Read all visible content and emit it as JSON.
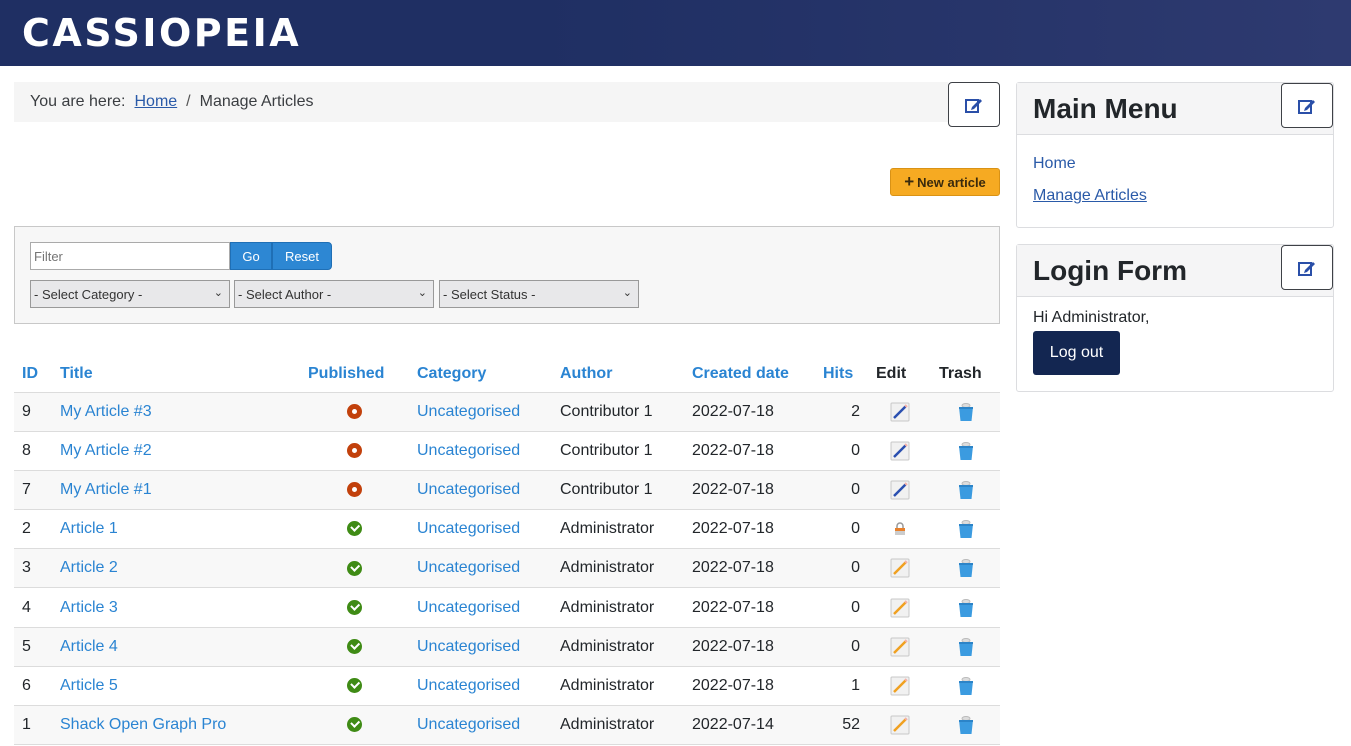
{
  "header": {
    "brand": "CASSIOPEIA"
  },
  "breadcrumb": {
    "prefix": "You are here:",
    "items": [
      {
        "label": "Home",
        "link": true
      },
      {
        "label": "Manage Articles",
        "link": false
      }
    ],
    "separator": "/",
    "edit_icon": "edit-icon"
  },
  "toolbar": {
    "new_article_label": "New article",
    "new_article_icon": "plus-icon"
  },
  "filters": {
    "filter_placeholder": "Filter",
    "filter_value": "",
    "go_label": "Go",
    "reset_label": "Reset",
    "category_selected": "- Select Category -",
    "author_selected": "- Select Author -",
    "status_selected": "- Select Status -"
  },
  "table": {
    "columns": [
      "ID",
      "Title",
      "Published",
      "Category",
      "Author",
      "Created date",
      "Hits",
      "Edit",
      "Trash"
    ],
    "rows": [
      {
        "id": "9",
        "title": "My Article #3",
        "published": "unpublished",
        "category": "Uncategorised",
        "author": "Contributor 1",
        "created": "2022-07-18",
        "hits": "2",
        "edit": "edit-icon",
        "trash": "trash-icon"
      },
      {
        "id": "8",
        "title": "My Article #2",
        "published": "unpublished",
        "category": "Uncategorised",
        "author": "Contributor 1",
        "created": "2022-07-18",
        "hits": "0",
        "edit": "edit-icon",
        "trash": "trash-icon"
      },
      {
        "id": "7",
        "title": "My Article #1",
        "published": "unpublished",
        "category": "Uncategorised",
        "author": "Contributor 1",
        "created": "2022-07-18",
        "hits": "0",
        "edit": "edit-icon",
        "trash": "trash-icon"
      },
      {
        "id": "2",
        "title": "Article 1",
        "published": "published",
        "category": "Uncategorised",
        "author": "Administrator",
        "created": "2022-07-18",
        "hits": "0",
        "edit": "lock-icon",
        "trash": "trash-icon"
      },
      {
        "id": "3",
        "title": "Article 2",
        "published": "published",
        "category": "Uncategorised",
        "author": "Administrator",
        "created": "2022-07-18",
        "hits": "0",
        "edit": "edit-disabled-icon",
        "trash": "trash-icon"
      },
      {
        "id": "4",
        "title": "Article 3",
        "published": "published",
        "category": "Uncategorised",
        "author": "Administrator",
        "created": "2022-07-18",
        "hits": "0",
        "edit": "edit-disabled-icon",
        "trash": "trash-icon"
      },
      {
        "id": "5",
        "title": "Article 4",
        "published": "published",
        "category": "Uncategorised",
        "author": "Administrator",
        "created": "2022-07-18",
        "hits": "0",
        "edit": "edit-disabled-icon",
        "trash": "trash-icon"
      },
      {
        "id": "6",
        "title": "Article 5",
        "published": "published",
        "category": "Uncategorised",
        "author": "Administrator",
        "created": "2022-07-18",
        "hits": "1",
        "edit": "edit-disabled-icon",
        "trash": "trash-icon"
      },
      {
        "id": "1",
        "title": "Shack Open Graph Pro",
        "published": "published",
        "category": "Uncategorised",
        "author": "Administrator",
        "created": "2022-07-14",
        "hits": "52",
        "edit": "edit-disabled-icon",
        "trash": "trash-icon"
      }
    ]
  },
  "sidebar": {
    "main_menu": {
      "title": "Main Menu",
      "items": [
        {
          "label": "Home",
          "active": false
        },
        {
          "label": "Manage Articles",
          "active": true
        }
      ]
    },
    "login_form": {
      "title": "Login Form",
      "greeting": "Hi Administrator,",
      "logout_label": "Log out"
    }
  },
  "colors": {
    "header_bg": "#1f2f63",
    "link": "#2a84d2",
    "new_article": "#f6aa22",
    "go_button": "#2d87d3",
    "logout": "#132651",
    "unpublished": "#c2410c",
    "published": "#3f8b15"
  }
}
